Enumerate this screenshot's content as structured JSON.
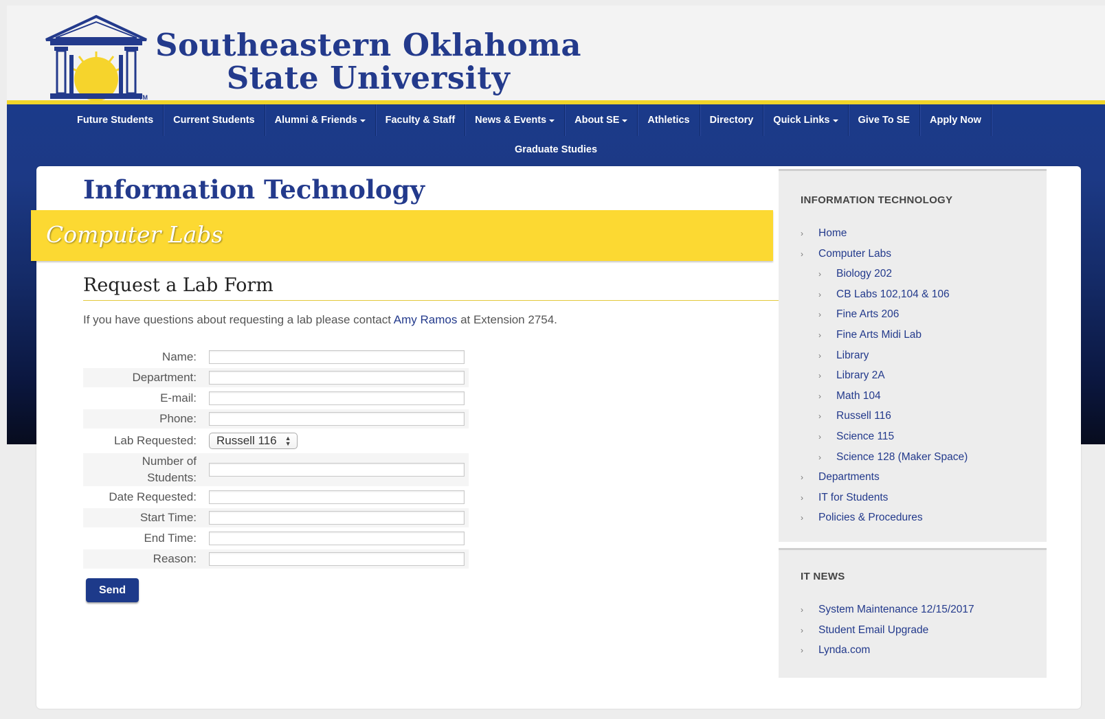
{
  "header": {
    "university_line1": "Southeastern Oklahoma",
    "university_line2": "State University",
    "logo_tm": "TM"
  },
  "nav": {
    "row1": [
      {
        "label": "Future Students",
        "dropdown": false
      },
      {
        "label": "Current Students",
        "dropdown": false
      },
      {
        "label": "Alumni & Friends",
        "dropdown": true
      },
      {
        "label": "Faculty & Staff",
        "dropdown": false
      },
      {
        "label": "News & Events",
        "dropdown": true
      },
      {
        "label": "About SE",
        "dropdown": true
      },
      {
        "label": "Athletics",
        "dropdown": false
      },
      {
        "label": "Directory",
        "dropdown": false
      },
      {
        "label": "Quick Links",
        "dropdown": true
      },
      {
        "label": "Give To SE",
        "dropdown": false
      },
      {
        "label": "Apply Now",
        "dropdown": false
      }
    ],
    "row2": [
      {
        "label": "Graduate Studies"
      }
    ]
  },
  "main": {
    "title": "Information Technology",
    "banner": "Computer Labs",
    "form_heading": "Request a Lab Form",
    "intro": {
      "before": "If you have questions about requesting a lab please contact ",
      "link": "Amy Ramos",
      "after": " at Extension 2754."
    },
    "fields": {
      "name": "Name:",
      "department": "Department:",
      "email": "E-mail:",
      "phone": "Phone:",
      "lab": "Lab Requested:",
      "students_line1": "Number of",
      "students_line2": "Students:",
      "date": "Date Requested:",
      "start": "Start Time:",
      "end": "End Time:",
      "reason": "Reason:"
    },
    "lab_selected": "Russell 116",
    "send_label": "Send"
  },
  "sidebar": {
    "section_title": "INFORMATION TECHNOLOGY",
    "items": [
      {
        "label": "Home",
        "level": 0
      },
      {
        "label": "Computer Labs",
        "level": 0
      },
      {
        "label": "Biology 202",
        "level": 1
      },
      {
        "label": "CB Labs 102,104 & 106",
        "level": 1
      },
      {
        "label": "Fine Arts 206",
        "level": 1
      },
      {
        "label": "Fine Arts Midi Lab",
        "level": 1
      },
      {
        "label": "Library",
        "level": 1
      },
      {
        "label": "Library 2A",
        "level": 1
      },
      {
        "label": "Math 104",
        "level": 1
      },
      {
        "label": "Russell 116",
        "level": 1
      },
      {
        "label": "Science 115",
        "level": 1
      },
      {
        "label": "Science 128 (Maker Space)",
        "level": 1
      },
      {
        "label": "Departments",
        "level": 0
      },
      {
        "label": "IT for Students",
        "level": 0
      },
      {
        "label": "Policies & Procedures",
        "level": 0
      }
    ],
    "news_title": "IT NEWS",
    "news": [
      {
        "label": "System Maintenance 12/15/2017"
      },
      {
        "label": "Student Email Upgrade"
      },
      {
        "label": "Lynda.com"
      }
    ]
  },
  "colors": {
    "brand_blue": "#233a8c",
    "nav_blue": "#1b3a8a",
    "gold": "#fcd932"
  }
}
